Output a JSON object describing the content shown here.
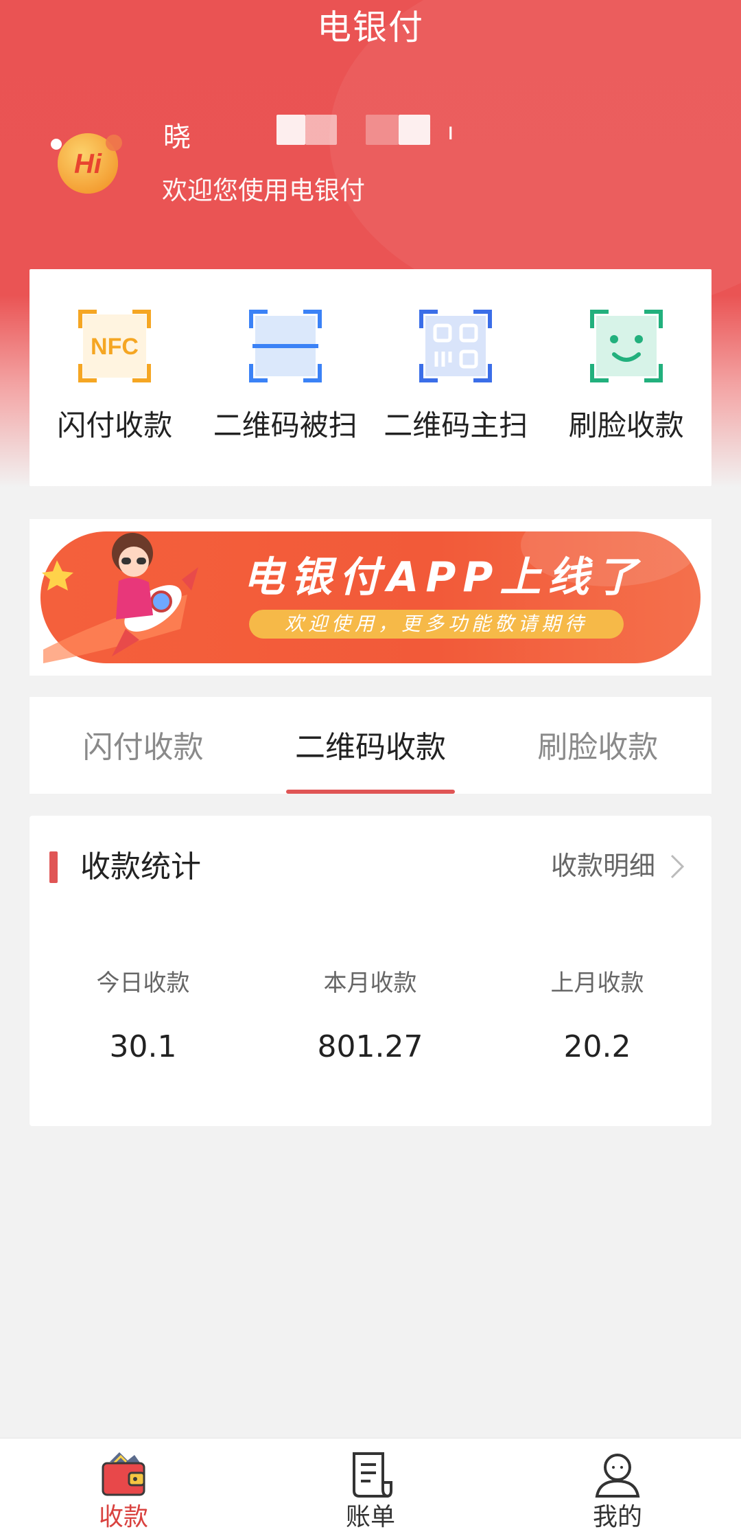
{
  "header": {
    "app_title": "电银付",
    "greeting_name": "晓",
    "greeting_trailing": "ı",
    "greeting_sub": "欢迎您使用电银付",
    "avatar_text": "Hi"
  },
  "quick_actions": [
    {
      "label": "闪付收款",
      "icon": "nfc-icon",
      "icon_text": "NFC",
      "color": "#f5a623"
    },
    {
      "label": "二维码被扫",
      "icon": "scan-frame-icon",
      "color": "#3b82f6"
    },
    {
      "label": "二维码主扫",
      "icon": "qr-code-icon",
      "color": "#3b6ee8"
    },
    {
      "label": "刷脸收款",
      "icon": "face-scan-icon",
      "color": "#22b07d"
    }
  ],
  "banner": {
    "title": "电银付APP上线了",
    "subtitle": "欢迎使用，更多功能敬请期待"
  },
  "tabs": [
    {
      "label": "闪付收款",
      "active": false
    },
    {
      "label": "二维码收款",
      "active": true
    },
    {
      "label": "刷脸收款",
      "active": false
    }
  ],
  "stats": {
    "title": "收款统计",
    "detail_link": "收款明细",
    "items": [
      {
        "label": "今日收款",
        "value": "30.1"
      },
      {
        "label": "本月收款",
        "value": "801.27"
      },
      {
        "label": "上月收款",
        "value": "20.2"
      }
    ]
  },
  "bottom_nav": [
    {
      "label": "收款",
      "icon": "wallet-icon",
      "active": true
    },
    {
      "label": "账单",
      "icon": "bill-icon",
      "active": false
    },
    {
      "label": "我的",
      "icon": "user-icon",
      "active": false
    }
  ],
  "colors": {
    "brand_red": "#ea5353",
    "accent_red": "#e05555",
    "active_nav": "#d9423f"
  }
}
